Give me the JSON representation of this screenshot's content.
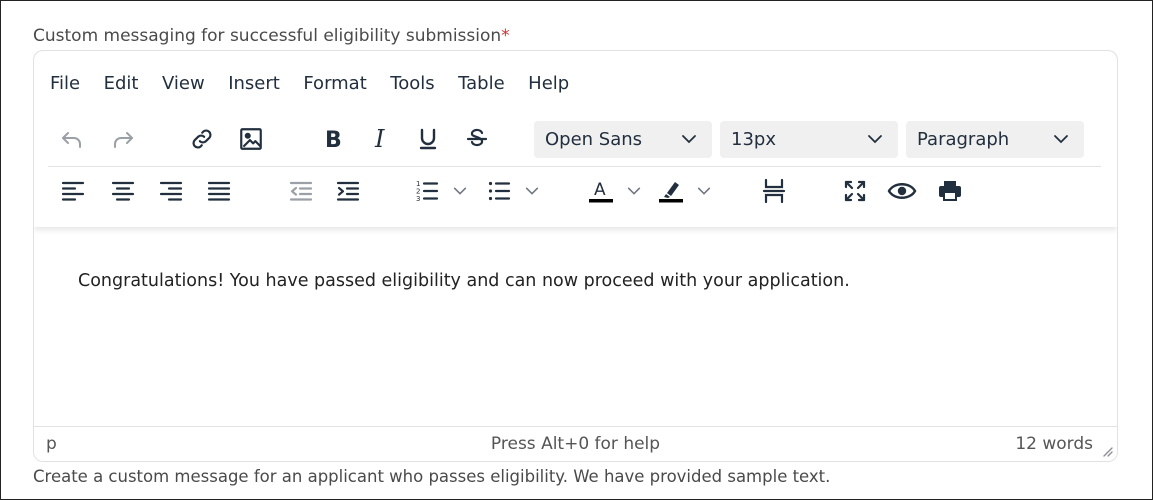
{
  "field": {
    "label": "Custom messaging for successful eligibility submission",
    "required_marker": "*",
    "helper_text": "Create a custom message for an applicant who passes eligibility. We have provided sample text."
  },
  "menubar": [
    "File",
    "Edit",
    "View",
    "Insert",
    "Format",
    "Tools",
    "Table",
    "Help"
  ],
  "toolbar": {
    "font_family": "Open Sans",
    "font_size": "13px",
    "block_format": "Paragraph"
  },
  "content": {
    "text": "Congratulations! You have passed eligibility and can now proceed with your application."
  },
  "statusbar": {
    "path": "p",
    "help": "Press Alt+0 for help",
    "word_count": "12 words"
  },
  "colors": {
    "text_color_swatch": "#000000",
    "highlight_color_swatch": "#000000",
    "required": "#d32f2f"
  }
}
